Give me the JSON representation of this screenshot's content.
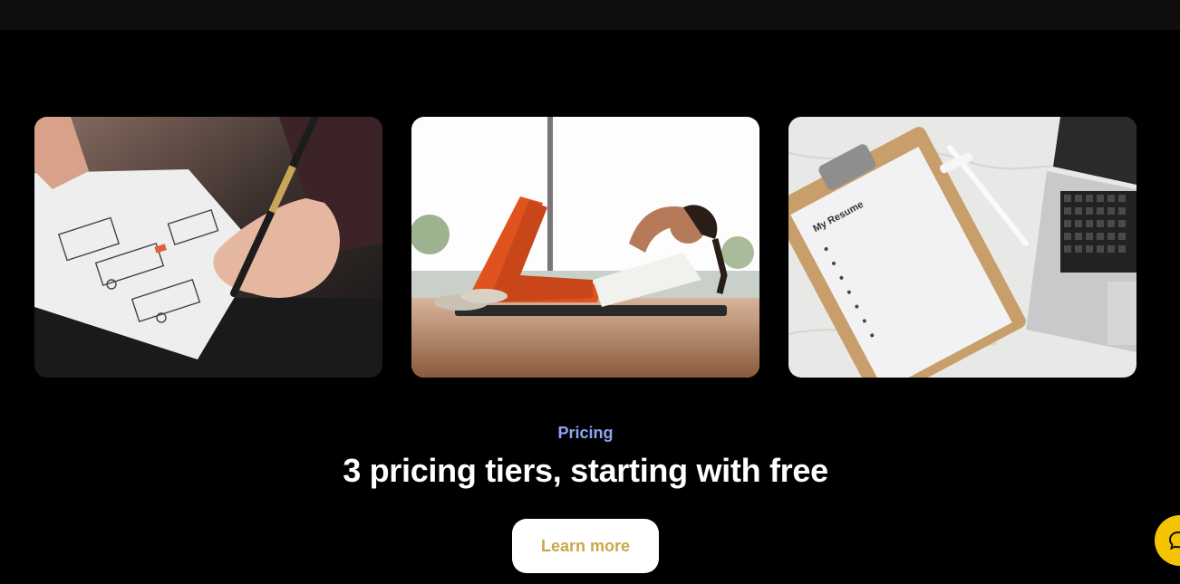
{
  "pricing": {
    "eyebrow": "Pricing",
    "headline": "3 pricing tiers, starting with free",
    "cta_label": "Learn more"
  },
  "gallery": {
    "images": [
      {
        "name": "wireframe-sketch-photo",
        "resume_text": ""
      },
      {
        "name": "workout-crunch-photo"
      },
      {
        "name": "resume-clipboard-photo",
        "clipboard_text": "My Resume"
      }
    ]
  },
  "colors": {
    "background": "#000000",
    "eyebrow": "#8ea5f3",
    "cta_text": "#c9a84a",
    "chat_button": "#f5c400"
  },
  "icons": {
    "chat": "chat-bubble-icon"
  }
}
